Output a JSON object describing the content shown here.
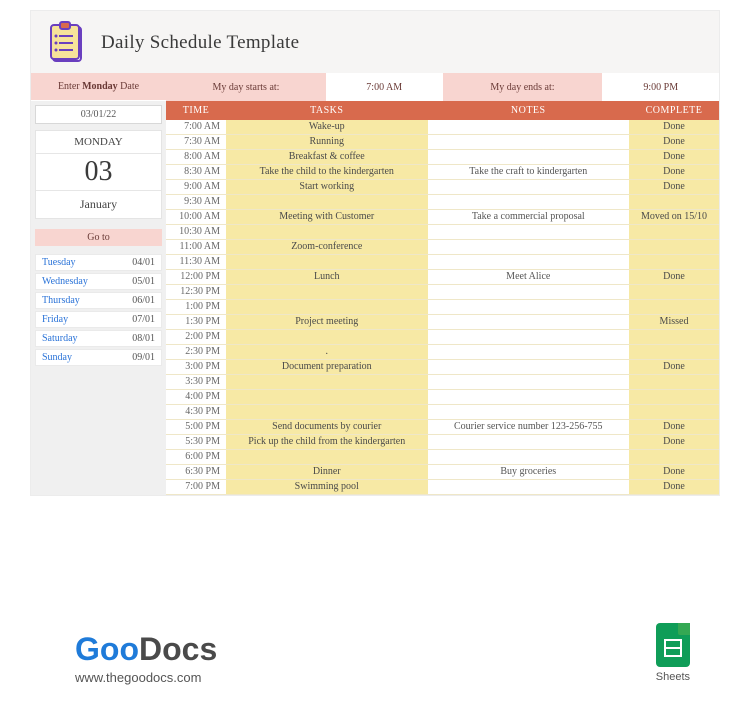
{
  "header": {
    "title": "Daily Schedule Template"
  },
  "enter_date_label_pre": "Enter ",
  "enter_date_label_bold": "Monday",
  "enter_date_label_post": " Date",
  "start_label": "My day starts at:",
  "start_value": "7:00 AM",
  "end_label": "My day ends at:",
  "end_value": "9:00 PM",
  "date_input": "03/01/22",
  "date_card": {
    "weekday": "MONDAY",
    "day": "03",
    "month": "January"
  },
  "goto_label": "Go to",
  "goto": [
    {
      "day": "Tuesday",
      "date": "04/01"
    },
    {
      "day": "Wednesday",
      "date": "05/01"
    },
    {
      "day": "Thursday",
      "date": "06/01"
    },
    {
      "day": "Friday",
      "date": "07/01"
    },
    {
      "day": "Saturday",
      "date": "08/01"
    },
    {
      "day": "Sunday",
      "date": "09/01"
    }
  ],
  "columns": {
    "time": "TIME",
    "tasks": "TASKS",
    "notes": "NOTES",
    "complete": "COMPLETE"
  },
  "rows": [
    {
      "time": "7:00 AM",
      "task": "Wake-up",
      "note": "",
      "complete": "Done"
    },
    {
      "time": "7:30 AM",
      "task": "Running",
      "note": "",
      "complete": "Done"
    },
    {
      "time": "8:00 AM",
      "task": "Breakfast & coffee",
      "note": "",
      "complete": "Done"
    },
    {
      "time": "8:30 AM",
      "task": "Take the child to the kindergarten",
      "note": "Take the craft to kindergarten",
      "complete": "Done"
    },
    {
      "time": "9:00 AM",
      "task": "Start working",
      "note": "",
      "complete": "Done"
    },
    {
      "time": "9:30 AM",
      "task": "",
      "note": "",
      "complete": ""
    },
    {
      "time": "10:00 AM",
      "task": "Meeting with Customer",
      "note": "Take a commercial proposal",
      "complete": "Moved on 15/10"
    },
    {
      "time": "10:30 AM",
      "task": "",
      "note": "",
      "complete": ""
    },
    {
      "time": "11:00 AM",
      "task": "Zoom-conference",
      "note": "",
      "complete": ""
    },
    {
      "time": "11:30 AM",
      "task": "",
      "note": "",
      "complete": ""
    },
    {
      "time": "12:00 PM",
      "task": "Lunch",
      "note": "Meet Alice",
      "complete": "Done"
    },
    {
      "time": "12:30 PM",
      "task": "",
      "note": "",
      "complete": ""
    },
    {
      "time": "1:00 PM",
      "task": "",
      "note": "",
      "complete": ""
    },
    {
      "time": "1:30 PM",
      "task": "Project meeting",
      "note": "",
      "complete": "Missed"
    },
    {
      "time": "2:00 PM",
      "task": "",
      "note": "",
      "complete": ""
    },
    {
      "time": "2:30 PM",
      "task": ".",
      "note": "",
      "complete": ""
    },
    {
      "time": "3:00 PM",
      "task": "Document preparation",
      "note": "",
      "complete": "Done"
    },
    {
      "time": "3:30 PM",
      "task": "",
      "note": "",
      "complete": ""
    },
    {
      "time": "4:00 PM",
      "task": "",
      "note": "",
      "complete": ""
    },
    {
      "time": "4:30 PM",
      "task": "",
      "note": "",
      "complete": ""
    },
    {
      "time": "5:00 PM",
      "task": "Send documents by courier",
      "note": "Courier service number 123-256-755",
      "complete": "Done"
    },
    {
      "time": "5:30 PM",
      "task": "Pick up the child from the kindergarten",
      "note": "",
      "complete": "Done"
    },
    {
      "time": "6:00 PM",
      "task": "",
      "note": "",
      "complete": ""
    },
    {
      "time": "6:30 PM",
      "task": "Dinner",
      "note": "Buy groceries",
      "complete": "Done"
    },
    {
      "time": "7:00 PM",
      "task": "Swimming pool",
      "note": "",
      "complete": "Done"
    }
  ],
  "branding": {
    "logo_prefix": "Goo",
    "logo_suffix": "Docs",
    "url": "www.thegoodocs.com",
    "sheets_label": "Sheets"
  }
}
